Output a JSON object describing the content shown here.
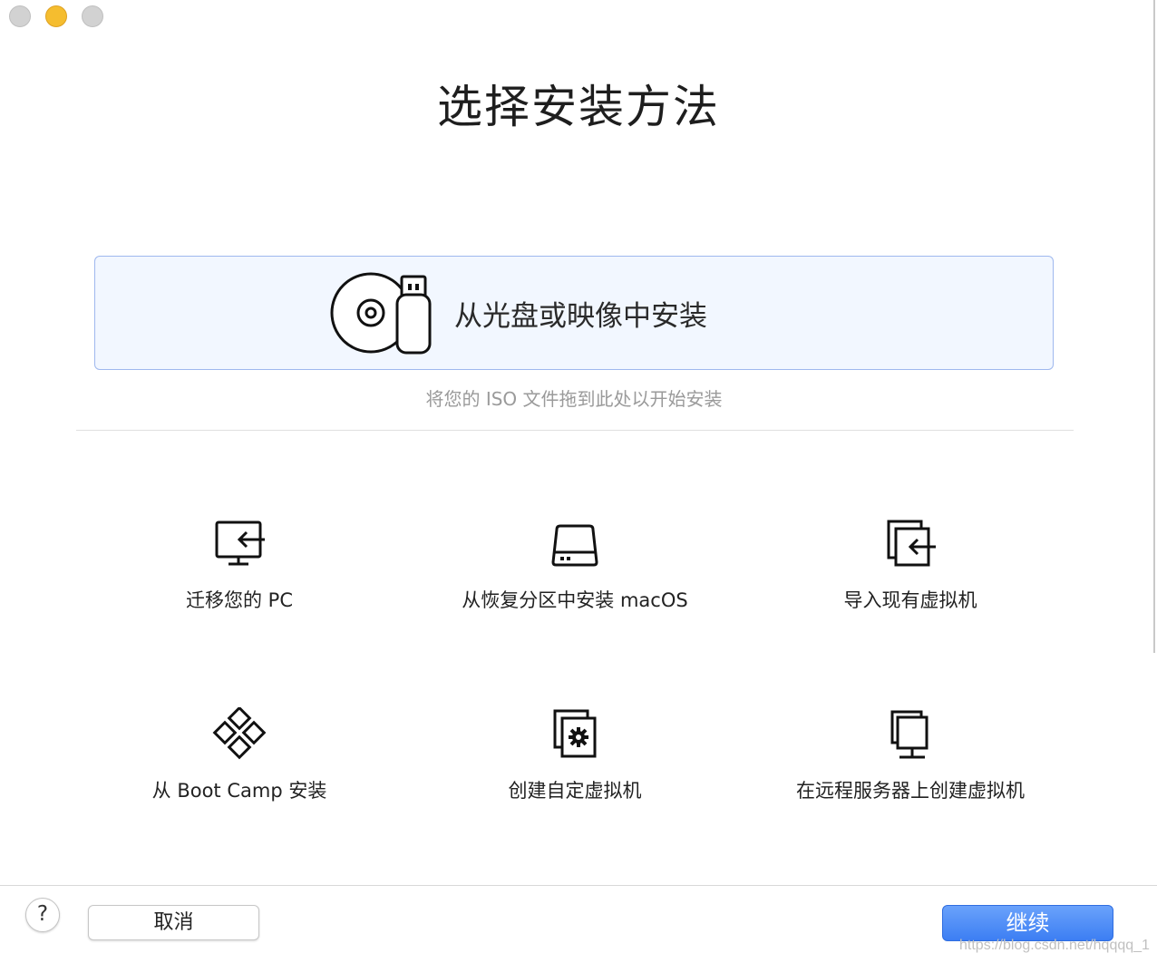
{
  "window": {
    "controls": [
      "close",
      "minimize",
      "zoom"
    ]
  },
  "title": "选择安装方法",
  "drop_zone": {
    "label": "从光盘或映像中安装",
    "icon": "disc-usb-icon",
    "hint": "将您的 ISO 文件拖到此处以开始安装"
  },
  "options": [
    {
      "label": "迁移您的 PC",
      "icon": "migrate-pc-icon"
    },
    {
      "label": "从恢复分区中安装 macOS",
      "icon": "hard-drive-icon"
    },
    {
      "label": "导入现有虚拟机",
      "icon": "import-vm-icon"
    },
    {
      "label": "从 Boot Camp 安装",
      "icon": "bootcamp-icon"
    },
    {
      "label": "创建自定虚拟机",
      "icon": "custom-vm-icon"
    },
    {
      "label": "在远程服务器上创建虚拟机",
      "icon": "remote-server-icon"
    }
  ],
  "footer": {
    "help_label": "?",
    "cancel_label": "取消",
    "continue_label": "继续"
  },
  "watermark": "https://blog.csdn.net/hqqqq_1",
  "colors": {
    "accent": "#3c7ef3",
    "drop_zone_bg": "#f2f7ff",
    "drop_zone_border": "#9fb8ee"
  }
}
